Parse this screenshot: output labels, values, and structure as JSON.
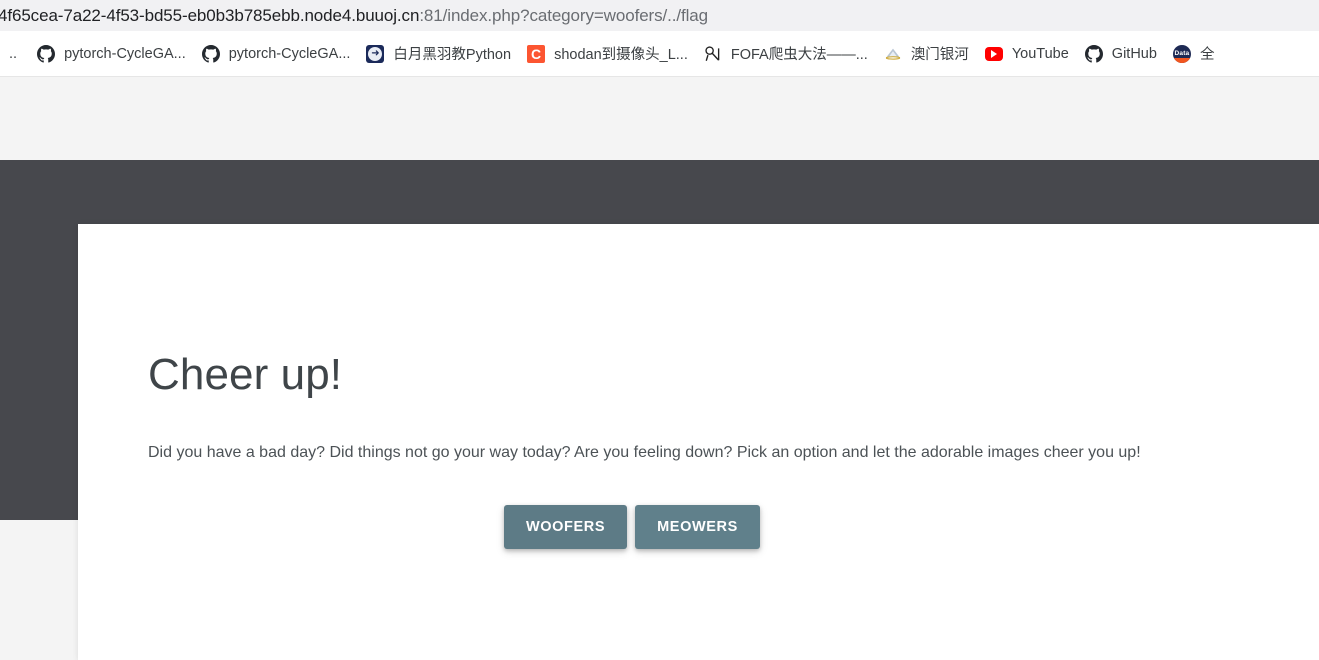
{
  "browser": {
    "url": {
      "visible_text": "4f65cea-7a22-4f53-bd55-eb0b3b785ebb.node4.buuoj.cn",
      "path": ":81/index.php?category=woofers/../flag"
    },
    "bookmarks": [
      {
        "label": "..",
        "icon": "ellipsis-icon",
        "icon_type": "ellipsis"
      },
      {
        "label": "pytorch-CycleGA...",
        "icon": "github-icon",
        "icon_type": "github"
      },
      {
        "label": "pytorch-CycleGA...",
        "icon": "github-icon",
        "icon_type": "github"
      },
      {
        "label": "白月黑羽教Python",
        "icon": "cnblogs-icon",
        "icon_type": "cnblogs"
      },
      {
        "label": "shodan到摄像头_L...",
        "icon": "csdn-icon",
        "icon_type": "csdn"
      },
      {
        "label": "FOFA爬虫大法——...",
        "icon": "fofa-icon",
        "icon_type": "fofa"
      },
      {
        "label": "澳门银河",
        "icon": "galaxy-icon",
        "icon_type": "galaxy"
      },
      {
        "label": "YouTube",
        "icon": "youtube-icon",
        "icon_type": "youtube"
      },
      {
        "label": "GitHub",
        "icon": "github-icon",
        "icon_type": "github"
      },
      {
        "label": "全",
        "icon": "data-icon",
        "icon_type": "data"
      }
    ]
  },
  "page": {
    "title": "Cheer up!",
    "description": "Did you have a bad day? Did things not go your way today? Are you feeling down? Pick an option and let the adorable images cheer you up!",
    "buttons": {
      "woofers": "WOOFERS",
      "meowers": "MEOWERS"
    }
  },
  "colors": {
    "hero_background": "#47484d",
    "page_background": "#f4f4f4",
    "card_background": "#ffffff",
    "button": "#5f7d88",
    "urlbar_background": "#f1f1f3",
    "heading_text": "#3f4549"
  }
}
